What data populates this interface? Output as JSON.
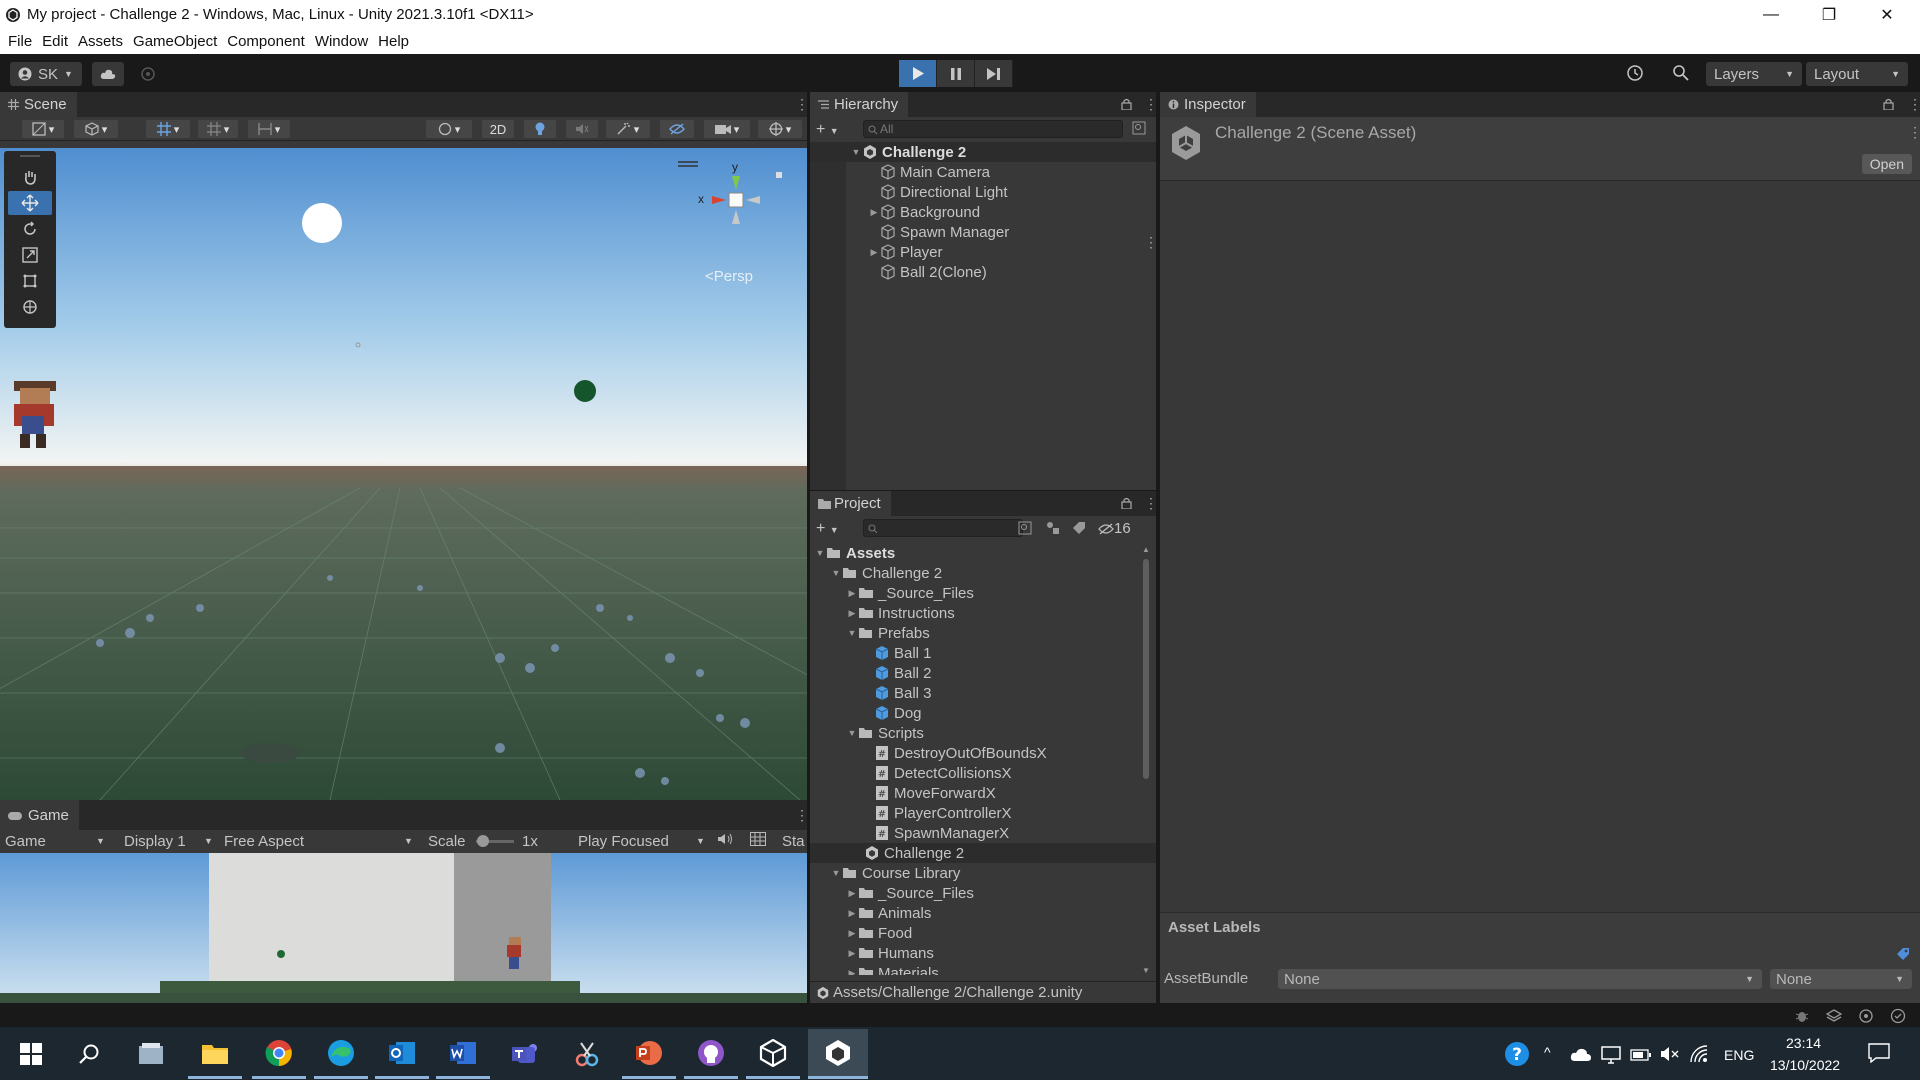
{
  "window": {
    "title": "My project - Challenge 2 - Windows, Mac, Linux - Unity 2021.3.10f1 <DX11>",
    "minimize": "—",
    "maximize": "❐",
    "close": "✕"
  },
  "menu": [
    "File",
    "Edit",
    "Assets",
    "GameObject",
    "Component",
    "Window",
    "Help"
  ],
  "toolbar": {
    "account": "SK",
    "layers": "Layers",
    "layout": "Layout"
  },
  "scene": {
    "tab": "Scene",
    "mode_2d": "2D",
    "persp": "<Persp",
    "gizmo_y": "y",
    "gizmo_x": "x"
  },
  "game": {
    "tab": "Game",
    "mode": "Game",
    "display": "Display 1",
    "aspect": "Free Aspect",
    "scale_label": "Scale",
    "scale_value": "1x",
    "play_focused": "Play Focused",
    "stats": "Sta"
  },
  "hierarchy": {
    "tab": "Hierarchy",
    "search_placeholder": "All",
    "scene": "Challenge 2",
    "items": [
      "Main Camera",
      "Directional Light",
      "Background",
      "Spawn Manager",
      "Player",
      "Ball 2(Clone)"
    ]
  },
  "project": {
    "tab": "Project",
    "hidden_count": "16",
    "root": "Assets",
    "rows": [
      {
        "label": "Challenge 2",
        "icon": "folder-open"
      },
      {
        "label": "_Source_Files",
        "icon": "folder"
      },
      {
        "label": "Instructions",
        "icon": "folder"
      },
      {
        "label": "Prefabs",
        "icon": "folder-open"
      },
      {
        "label": "Ball 1",
        "icon": "prefab"
      },
      {
        "label": "Ball 2",
        "icon": "prefab"
      },
      {
        "label": "Ball 3",
        "icon": "prefab"
      },
      {
        "label": "Dog",
        "icon": "prefab"
      },
      {
        "label": "Scripts",
        "icon": "folder-open"
      },
      {
        "label": "DestroyOutOfBoundsX",
        "icon": "script"
      },
      {
        "label": "DetectCollisionsX",
        "icon": "script"
      },
      {
        "label": "MoveForwardX",
        "icon": "script"
      },
      {
        "label": "PlayerControllerX",
        "icon": "script"
      },
      {
        "label": "SpawnManagerX",
        "icon": "script"
      },
      {
        "label": "Challenge 2",
        "icon": "unity-scene"
      },
      {
        "label": "Course Library",
        "icon": "folder-open"
      },
      {
        "label": "_Source_Files",
        "icon": "folder"
      },
      {
        "label": "Animals",
        "icon": "folder"
      },
      {
        "label": "Food",
        "icon": "folder"
      },
      {
        "label": "Humans",
        "icon": "folder"
      },
      {
        "label": "Materials",
        "icon": "folder"
      }
    ],
    "path": "Assets/Challenge 2/Challenge 2.unity"
  },
  "inspector": {
    "tab": "Inspector",
    "object_title": "Challenge 2 (Scene Asset)",
    "open_button": "Open",
    "asset_labels": "Asset Labels",
    "assetbundle_label": "AssetBundle",
    "assetbundle_value": "None",
    "variant_value": "None"
  },
  "taskbar": {
    "language": "ENG",
    "time": "23:14",
    "date": "13/10/2022"
  },
  "colors": {
    "editor_bg": "#383838",
    "dark_bg": "#191919",
    "accent_blue": "#3a72b0",
    "selection": "#2c2c2c"
  }
}
